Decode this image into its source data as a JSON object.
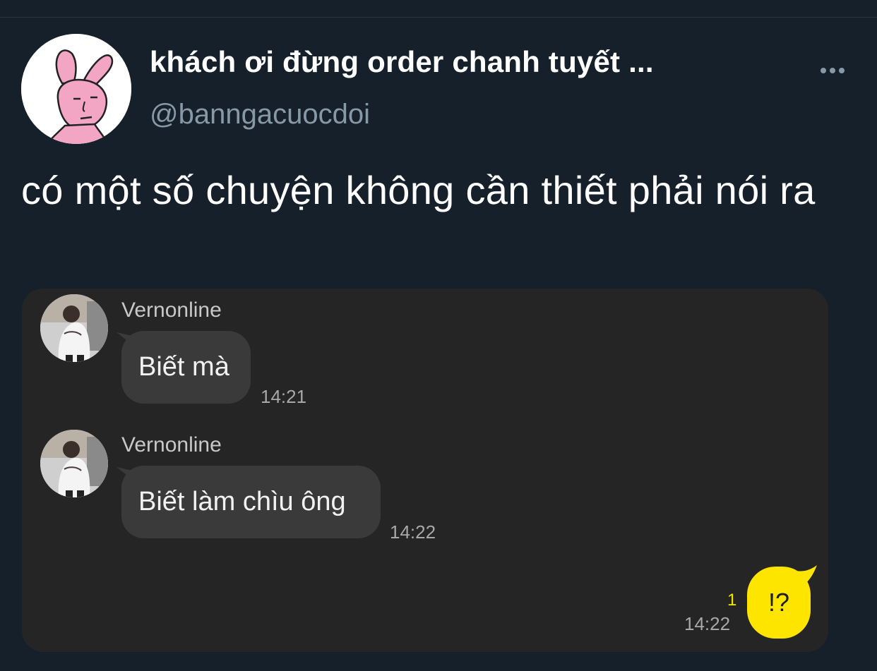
{
  "tweet": {
    "display_name": "khách ơi đừng order chanh tuyết ...",
    "handle": "@banngacuocdoi",
    "text": "có một số chuyện không cần thiết phải nói ra",
    "avatar_icon": "pink-bunny-avatar",
    "more_icon": "more-options-icon"
  },
  "chat": {
    "messages": [
      {
        "sender": "Vernonline",
        "text": "Biết mà",
        "time": "14:21"
      },
      {
        "sender": "Vernonline",
        "text": "Biết làm chìu ông",
        "time": "14:22"
      }
    ],
    "own_message": {
      "text": "!?",
      "time": "14:22",
      "unread_count": "1"
    }
  },
  "colors": {
    "background": "#15202b",
    "handle": "#8899a6",
    "chat_background": "#252526",
    "incoming_bubble": "#3a3a3a",
    "outgoing_bubble": "#fee500",
    "unread_count": "#f7e600"
  }
}
